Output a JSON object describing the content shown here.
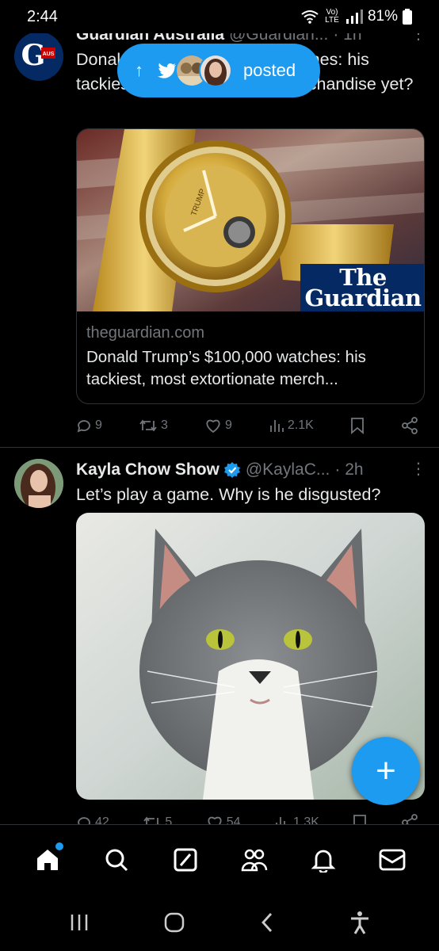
{
  "status_bar": {
    "time": "2:44",
    "network": "Vo) LTE",
    "battery": "81%"
  },
  "pill": {
    "arrow": "↑",
    "label": "posted"
  },
  "tweets": [
    {
      "name": "Guardian Australia",
      "handle": "@Guardian...",
      "time": "· 1h",
      "avatar_text": "AUS",
      "text": "Donald Trump's $100,000 watches: his tackiest, most extortionate merchandise yet?",
      "card": {
        "image_brand": "The Guardian",
        "watch_engraving": "TRUMP",
        "domain": "theguardian.com",
        "title": "Donald Trump’s $100,000 watches: his tackiest, most extortionate merch..."
      },
      "actions": {
        "replies": "9",
        "retweets": "3",
        "likes": "9",
        "views": "2.1K"
      }
    },
    {
      "name": "Kayla Chow Show",
      "verified": true,
      "handle": "@KaylaC...",
      "time": "· 2h",
      "text": "Let’s play a game. Why is he disgusted?",
      "actions": {
        "replies": "42",
        "retweets": "5",
        "likes": "54",
        "views": "1.3K"
      }
    }
  ],
  "fab": {
    "icon": "plus-icon",
    "label": "+"
  },
  "bottom_nav": [
    "home-icon",
    "search-icon",
    "grok-icon",
    "communities-icon",
    "notifications-icon",
    "messages-icon"
  ],
  "colors": {
    "accent": "#1d9bf0",
    "background": "#000000",
    "muted": "#71767b",
    "guardian_blue": "#052962"
  }
}
